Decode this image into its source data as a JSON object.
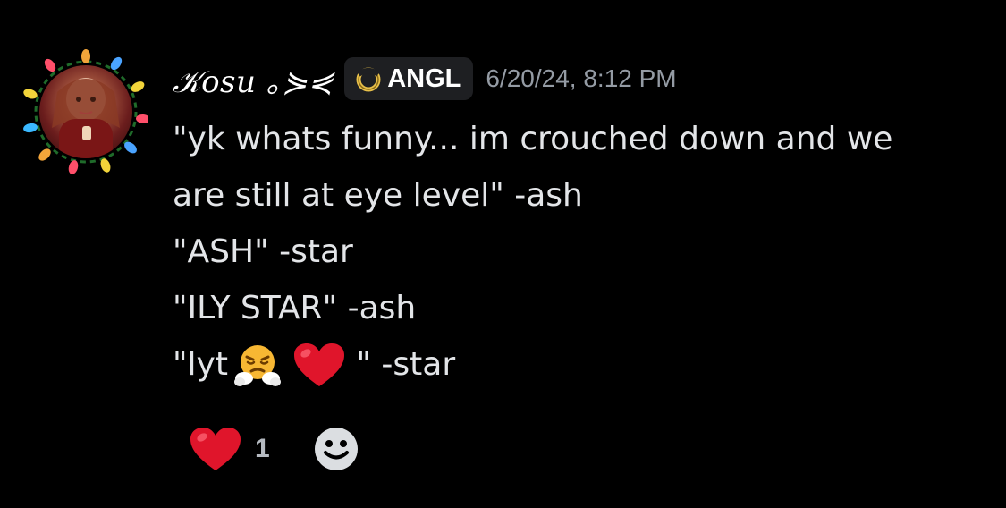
{
  "message": {
    "author": "𝒦osu ｡⋟⋞",
    "role_tag": {
      "icon": "halo-icon",
      "label": "ANGL"
    },
    "timestamp": "6/20/24, 8:12 PM",
    "lines": [
      "\"yk whats funny... im crouched down and we",
      "are still at eye level\" -ash",
      "\"ASH\" -star",
      "\"ILY STAR\" -ash",
      {
        "prefix": "\"lyt",
        "emojis": [
          "face-with-steam-from-nose",
          "red-heart"
        ],
        "suffix": " \" -star"
      }
    ],
    "reactions": [
      {
        "emoji": "red-heart",
        "count": "1"
      }
    ],
    "add_reaction_icon": "smiley-add-reaction-icon"
  },
  "colors": {
    "background": "#000000",
    "username": "#ffffff",
    "timestamp": "#949ba4",
    "text": "#e3e5e8",
    "tag_bg": "#1e1f22"
  }
}
